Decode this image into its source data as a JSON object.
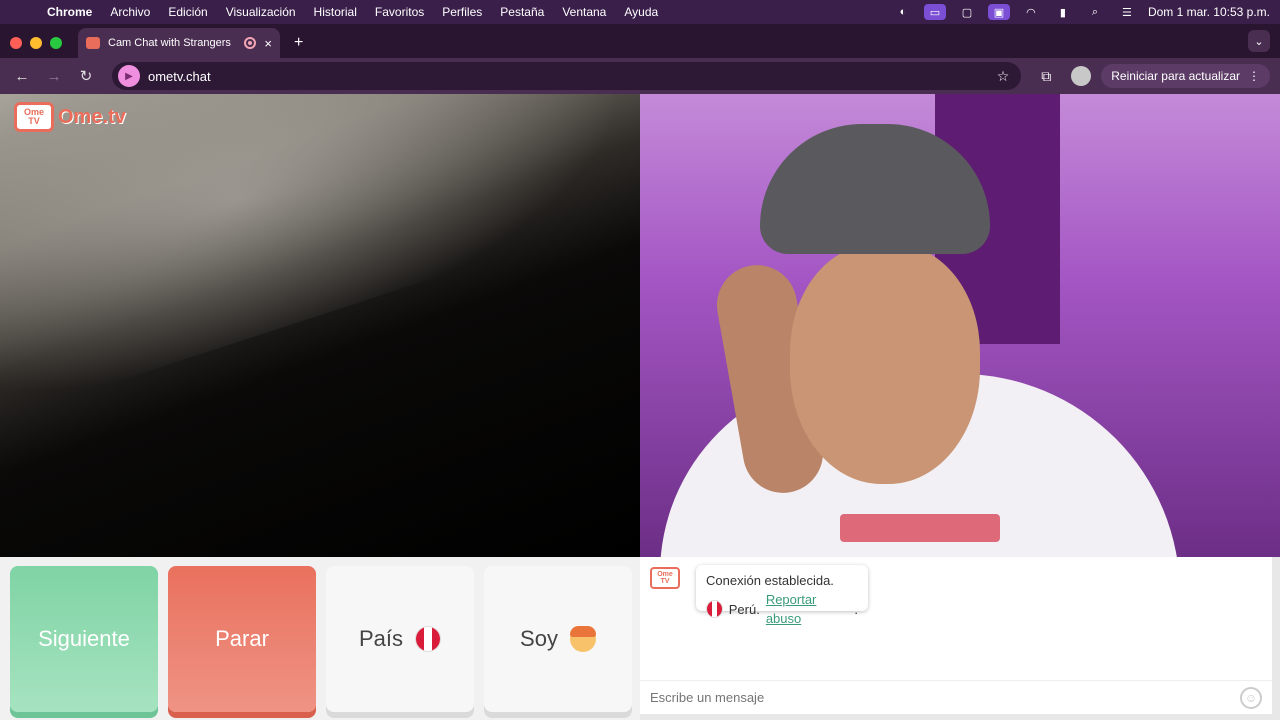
{
  "menubar": {
    "app": "Chrome",
    "items": [
      "Archivo",
      "Edición",
      "Visualización",
      "Historial",
      "Favoritos",
      "Perfiles",
      "Pestaña",
      "Ventana",
      "Ayuda"
    ],
    "clock": "Dom 1 mar.  10:53 p.m."
  },
  "tab": {
    "title": "Cam Chat with Strangers",
    "close": "×"
  },
  "newtab": "+",
  "address": {
    "url": "ometv.chat"
  },
  "update_button": {
    "label": "Reiniciar para actualizar",
    "more": "⋮"
  },
  "logo": {
    "tv_top": "Ome",
    "tv_bottom": "TV",
    "word": "Ome.tv"
  },
  "controls": {
    "next": "Siguiente",
    "stop": "Parar",
    "country": "País",
    "gender": "Soy"
  },
  "chat": {
    "icon_top": "Ome",
    "icon_bottom": "TV",
    "status": "Conexión establecida.",
    "country": "Perú.",
    "report_link": "Reportar abuso",
    "input_placeholder": "Escribe un mensaje"
  },
  "colors": {
    "next": "#7fd3a4",
    "stop": "#e9715d",
    "brand": "#e96d5a",
    "link": "#3a9b7a"
  },
  "icons": [
    "apple-icon",
    "back-icon",
    "forward-icon",
    "reload-icon",
    "star-icon",
    "extensions-icon",
    "flag-peru-icon",
    "boy-face-icon",
    "smiley-icon"
  ]
}
